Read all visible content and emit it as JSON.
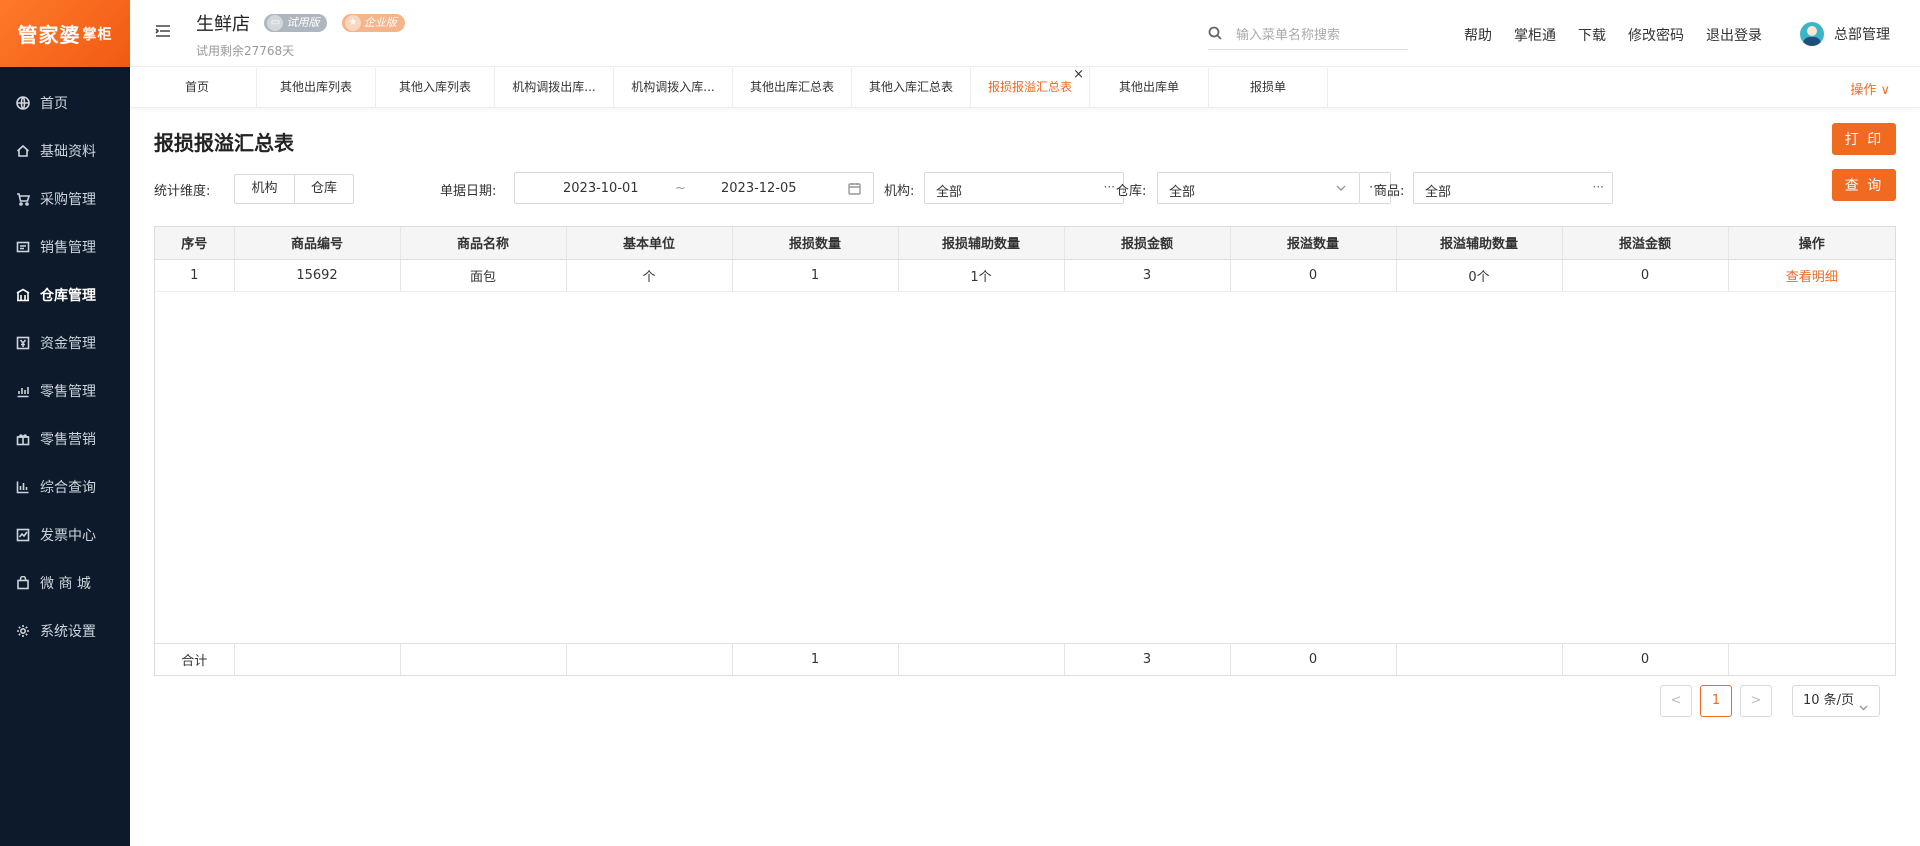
{
  "brand": {
    "logo_main": "管家婆",
    "logo_sub": "掌柜"
  },
  "sidebar": {
    "items": [
      {
        "label": "首页",
        "icon": "globe-icon"
      },
      {
        "label": "基础资料",
        "icon": "home-icon"
      },
      {
        "label": "采购管理",
        "icon": "cart-icon"
      },
      {
        "label": "销售管理",
        "icon": "sales-icon"
      },
      {
        "label": "仓库管理",
        "icon": "warehouse-icon",
        "active": true
      },
      {
        "label": "资金管理",
        "icon": "money-icon"
      },
      {
        "label": "零售管理",
        "icon": "retail-icon"
      },
      {
        "label": "零售营销",
        "icon": "gift-icon"
      },
      {
        "label": "综合查询",
        "icon": "chart-icon"
      },
      {
        "label": "发票中心",
        "icon": "invoice-icon"
      },
      {
        "label": "微 商 城",
        "icon": "bag-icon"
      },
      {
        "label": "系统设置",
        "icon": "gear-icon"
      }
    ]
  },
  "header": {
    "store_name": "生鲜店",
    "badge_trial": "试用版",
    "badge_enterprise": "企业版",
    "trial_remaining": "试用剩余27768天",
    "search_placeholder": "输入菜单名称搜索",
    "links": [
      "帮助",
      "掌柜通",
      "下载",
      "修改密码",
      "退出登录"
    ],
    "user_name": "总部管理"
  },
  "tabs": {
    "items": [
      "首页",
      "其他出库列表",
      "其他入库列表",
      "机构调拨出库...",
      "机构调拨入库...",
      "其他出库汇总表",
      "其他入库汇总表",
      "报损报溢汇总表",
      "其他出库单",
      "报损单"
    ],
    "active_index": 7,
    "ops_label": "操作 ∨"
  },
  "page": {
    "title": "报损报溢汇总表",
    "print_label": "打 印",
    "query_label": "查 询"
  },
  "filters": {
    "dimension_label": "统计维度:",
    "dimension_options": [
      "机构",
      "仓库"
    ],
    "date_label": "单据日期:",
    "date_start": "2023-10-01",
    "date_sep": "~",
    "date_end": "2023-12-05",
    "org_label": "机构:",
    "org_value": "全部",
    "warehouse_label": "仓库:",
    "warehouse_value": "全部",
    "goods_label": "商品:",
    "goods_value": "全部",
    "more": "···"
  },
  "table": {
    "columns": [
      "序号",
      "商品编号",
      "商品名称",
      "基本单位",
      "报损数量",
      "报损辅助数量",
      "报损金额",
      "报溢数量",
      "报溢辅助数量",
      "报溢金额",
      "操作"
    ],
    "rows": [
      [
        "1",
        "15692",
        "面包",
        "个",
        "1",
        "1个",
        "3",
        "0",
        "0个",
        "0",
        "查看明细"
      ]
    ],
    "totals": [
      "合计",
      "",
      "",
      "",
      "1",
      "",
      "3",
      "0",
      "",
      "0",
      ""
    ]
  },
  "pagination": {
    "prev": "<",
    "current": "1",
    "next": ">",
    "page_size": "10 条/页"
  },
  "colors": {
    "accent": "#f06b21",
    "sidebar_bg": "#0d1a2b"
  }
}
